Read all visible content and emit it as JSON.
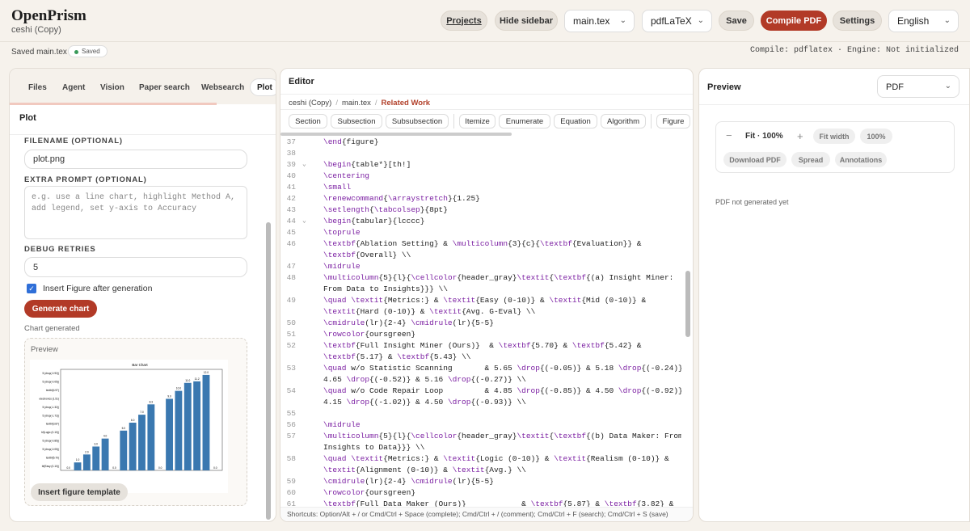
{
  "app": {
    "title": "OpenPrism",
    "subtitle": "ceshi (Copy)"
  },
  "topbar": {
    "projects": "Projects",
    "hide_sidebar": "Hide sidebar",
    "file_select": "main.tex",
    "engine_select": "pdfLaTeX",
    "save": "Save",
    "compile": "Compile PDF",
    "settings": "Settings",
    "language": "English"
  },
  "status": {
    "saved_text": "Saved main.tex",
    "saved_badge": "Saved",
    "engine_info": "Compile: pdflatex · Engine: Not initialized"
  },
  "left": {
    "tabs": [
      "Files",
      "Agent",
      "Vision",
      "Paper search",
      "Websearch",
      "Plot"
    ],
    "title": "Plot",
    "filename_label": "FILENAME (OPTIONAL)",
    "filename_value": "plot.png",
    "extra_label": "EXTRA PROMPT (OPTIONAL)",
    "extra_placeholder": "e.g. use a line chart, highlight Method A,\nadd legend, set y-axis to Accuracy",
    "debug_label": "DEBUG RETRIES",
    "debug_value": "5",
    "insert_checkbox": "Insert Figure after generation",
    "generate": "Generate chart",
    "chart_generated": "Chart generated",
    "preview_label": "Preview",
    "insert_template": "Insert figure template"
  },
  "editor": {
    "title": "Editor",
    "breadcrumb": [
      "ceshi (Copy)",
      "main.tex",
      "Related Work"
    ],
    "toolbar": [
      "Section",
      "Subsection",
      "Subsubsection",
      "Itemize",
      "Enumerate",
      "Equation",
      "Algorithm",
      "Figure"
    ],
    "lines": [
      {
        "n": "37",
        "t": "\\end{figure}"
      },
      {
        "n": "38",
        "t": ""
      },
      {
        "n": "39",
        "f": true,
        "t": "\\begin{table*}[th!]"
      },
      {
        "n": "40",
        "t": "\\centering"
      },
      {
        "n": "41",
        "t": "\\small"
      },
      {
        "n": "42",
        "t": "\\renewcommand{\\arraystretch}{1.25}"
      },
      {
        "n": "43",
        "t": "\\setlength{\\tabcolsep}{8pt}"
      },
      {
        "n": "44",
        "f": true,
        "t": "\\begin{tabular}{lcccc}"
      },
      {
        "n": "45",
        "t": "\\toprule"
      },
      {
        "n": "46",
        "t": "\\textbf{Ablation Setting} & \\multicolumn{3}{c}{\\textbf{Evaluation}} &"
      },
      {
        "n": "",
        "t": "\\textbf{Overall} \\\\"
      },
      {
        "n": "47",
        "t": "\\midrule"
      },
      {
        "n": "48",
        "t": "\\multicolumn{5}{l}{\\cellcolor{header_gray}\\textit{\\textbf{(a) Insight Miner:"
      },
      {
        "n": "",
        "t": "From Data to Insights}}} \\\\"
      },
      {
        "n": "49",
        "t": "\\quad \\textit{Metrics:} & \\textit{Easy (0-10)} & \\textit{Mid (0-10)} &"
      },
      {
        "n": "",
        "t": "\\textit{Hard (0-10)} & \\textit{Avg. G-Eval} \\\\"
      },
      {
        "n": "50",
        "t": "\\cmidrule(lr){2-4} \\cmidrule(lr){5-5}"
      },
      {
        "n": "51",
        "t": "\\rowcolor{oursgreen}"
      },
      {
        "n": "52",
        "t": "\\textbf{Full Insight Miner (Ours)}  & \\textbf{5.70} & \\textbf{5.42} &"
      },
      {
        "n": "",
        "t": "\\textbf{5.17} & \\textbf{5.43} \\\\"
      },
      {
        "n": "53",
        "t": "\\quad w/o Statistic Scanning       & 5.65 \\drop{(-0.05)} & 5.18 \\drop{(-0.24)} &"
      },
      {
        "n": "",
        "t": "4.65 \\drop{(-0.52)} & 5.16 \\drop{(-0.27)} \\\\"
      },
      {
        "n": "54",
        "t": "\\quad w/o Code Repair Loop         & 4.85 \\drop{(-0.85)} & 4.50 \\drop{(-0.92)} &"
      },
      {
        "n": "",
        "t": "4.15 \\drop{(-1.02)} & 4.50 \\drop{(-0.93)} \\\\"
      },
      {
        "n": "55",
        "t": ""
      },
      {
        "n": "56",
        "t": "\\midrule"
      },
      {
        "n": "57",
        "t": "\\multicolumn{5}{l}{\\cellcolor{header_gray}\\textit{\\textbf{(b) Data Maker: From"
      },
      {
        "n": "",
        "t": "Insights to Data}}} \\\\"
      },
      {
        "n": "58",
        "t": "\\quad \\textit{Metrics:} & \\textit{Logic (0-10)} & \\textit{Realism (0-10)} &"
      },
      {
        "n": "",
        "t": "\\textit{Alignment (0-10)} & \\textit{Avg.} \\\\"
      },
      {
        "n": "59",
        "t": "\\cmidrule(lr){2-4} \\cmidrule(lr){5-5}"
      },
      {
        "n": "60",
        "t": "\\rowcolor{oursgreen}"
      },
      {
        "n": "61",
        "t": "\\textbf{Full Data Maker (Ours)}            & \\textbf{5.87} & \\textbf{3.82} &"
      }
    ],
    "shortcuts": "Shortcuts: Option/Alt + / or Cmd/Ctrl + Space (complete); Cmd/Ctrl + / (comment); Cmd/Ctrl + F (search); Cmd/Ctrl + S (save)"
  },
  "right": {
    "title": "Preview",
    "view_select": "PDF",
    "zoom_out": "−",
    "fit": "Fit · 100%",
    "zoom_in": "+",
    "fit_width": "Fit width",
    "percent": "100%",
    "download": "Download PDF",
    "spread": "Spread",
    "annotations": "Annotations",
    "empty": "PDF not generated yet"
  },
  "colors": {
    "accent": "#b23a27",
    "bar": "#3a78b0"
  },
  "chart_data": {
    "type": "bar",
    "title": "Bar Chart",
    "values": [
      0.0,
      1.0,
      2.0,
      3.0,
      4.0,
      0.0,
      5.0,
      6.0,
      7.0,
      8.3,
      0.0,
      9.0,
      10.0,
      11.0,
      11.2,
      12.0,
      0.0
    ],
    "ylabels": [
      "5 (drop(-0.92))",
      "5 (drop(-0.05))",
      "textbf(4.97)",
      "electronics (1.51)",
      "5 (drop(-1.32))",
      "5 (drop(-1.72))",
      "textbf(3.87)",
      "bf(Logic (0-10))",
      "5 (drop(-0.85))",
      "5 (drop(-0.05))",
      "textbf(5.70)",
      "bf(Easy (0-10))"
    ]
  }
}
